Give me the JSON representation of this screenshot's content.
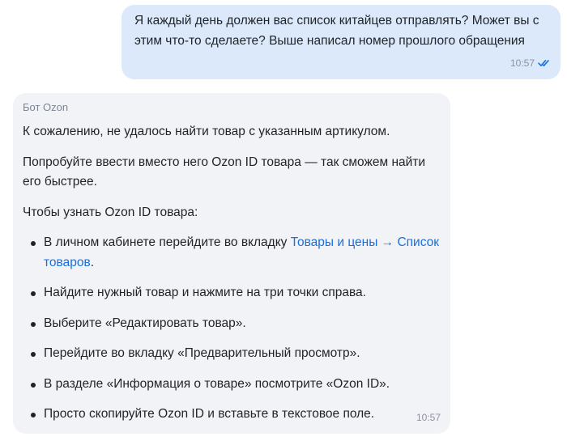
{
  "user_message": {
    "text": "Я каждый день должен вас список китайцев отправлять? Может вы с этим что-то сделаете? Выше написал номер прошлого обращения",
    "time": "10:57",
    "status_icon": "double-check-icon"
  },
  "bot_message": {
    "sender": "Бот Ozon",
    "paragraphs": [
      "К сожалению, не удалось найти товар с указанным артикулом.",
      "Попробуйте ввести вместо него Ozon ID товара — так сможем найти его быстрее.",
      "Чтобы узнать Ozon ID товара:"
    ],
    "steps": {
      "s1_before": "В личном кабинете перейдите во вкладку ",
      "s1_link": "Товары и цены → Список товаров",
      "s1_after": ".",
      "s2": "Найдите нужный товар и нажмите на три точки справа.",
      "s3": "Выберите «Редактировать товар».",
      "s4": "Перейдите во вкладку «Предварительный просмотр».",
      "s5": "В разделе «Информация о товаре» посмотрите «Ozon ID».",
      "s6": "Просто скопируйте Ozon ID и вставьте в текстовое поле."
    },
    "time": "10:57"
  },
  "colors": {
    "user_bubble": "#dbe9fb",
    "bot_bubble": "#f2f3f6",
    "link": "#1a6fe0",
    "check": "#1a6fe0",
    "meta_text": "#8b93a1"
  }
}
